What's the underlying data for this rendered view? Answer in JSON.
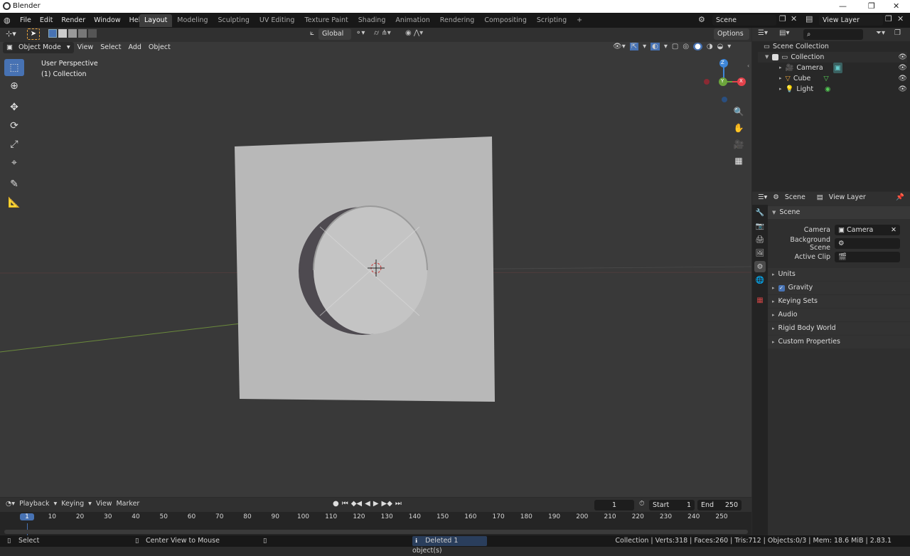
{
  "window": {
    "title": "Blender",
    "controls": [
      "—",
      "❐",
      "✕"
    ]
  },
  "menus": [
    "File",
    "Edit",
    "Render",
    "Window",
    "Help"
  ],
  "workspaces": [
    {
      "label": "Layout",
      "active": true
    },
    {
      "label": "Modeling"
    },
    {
      "label": "Sculpting"
    },
    {
      "label": "UV Editing"
    },
    {
      "label": "Texture Paint"
    },
    {
      "label": "Shading"
    },
    {
      "label": "Animation"
    },
    {
      "label": "Rendering"
    },
    {
      "label": "Compositing"
    },
    {
      "label": "Scripting"
    }
  ],
  "add_tab": "+",
  "scene_field": "Scene",
  "viewlayer_field": "View Layer",
  "viewport": {
    "transform": "Global",
    "options": "Options",
    "mode": "Object Mode",
    "menus": [
      "View",
      "Select",
      "Add",
      "Object"
    ],
    "overlay_line1": "User Perspective",
    "overlay_line2": "(1) Collection",
    "gizmo": {
      "z": "Z",
      "y": "Y",
      "x": "X"
    }
  },
  "outliner": {
    "search_placeholder": "",
    "root": "Scene Collection",
    "collection": "Collection",
    "items": [
      {
        "name": "Camera"
      },
      {
        "name": "Cube"
      },
      {
        "name": "Light"
      }
    ]
  },
  "properties": {
    "tab_scene": "Scene",
    "tab_viewlayer": "View Layer",
    "section": "Scene",
    "camera_label": "Camera",
    "camera_value": "Camera",
    "bgscene_label": "Background Scene",
    "activeclip_label": "Active Clip",
    "subsections": [
      "Units",
      "Gravity",
      "Keying Sets",
      "Audio",
      "Rigid Body World",
      "Custom Properties"
    ]
  },
  "timeline": {
    "menus": [
      "Playback",
      "Keying",
      "View",
      "Marker"
    ],
    "current_frame": "1",
    "start_label": "Start",
    "start_value": "1",
    "end_label": "End",
    "end_value": "250",
    "ticks": [
      "1",
      "10",
      "20",
      "30",
      "40",
      "50",
      "60",
      "70",
      "80",
      "90",
      "100",
      "110",
      "120",
      "130",
      "140",
      "150",
      "160",
      "170",
      "180",
      "190",
      "200",
      "210",
      "220",
      "230",
      "240",
      "250"
    ]
  },
  "status": {
    "select": "Select",
    "center": "Center View to Mouse",
    "message": "Deleted 1 object(s)",
    "stats": "Collection | Verts:318 | Faces:260 | Tris:712 | Objects:0/3 | Mem: 18.6 MiB | 2.83.1"
  },
  "colors": {
    "accent": "#4772b3",
    "gizmo_x": "#e3424b",
    "gizmo_y": "#6ca53c",
    "gizmo_z": "#3e86d8"
  }
}
